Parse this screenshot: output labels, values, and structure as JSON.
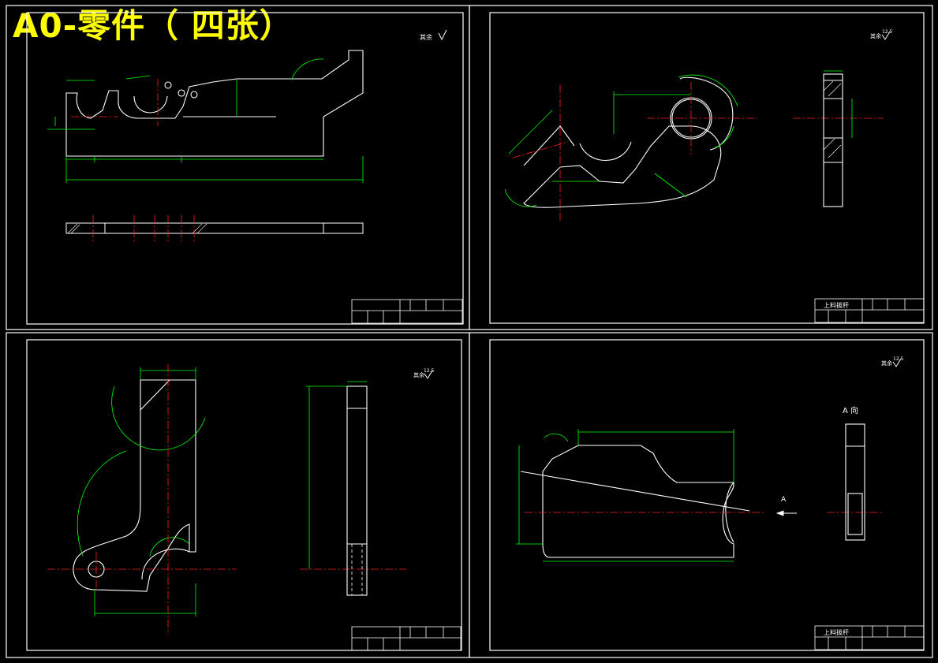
{
  "banner": {
    "title": "A0-零件（ 四张）"
  },
  "colors": {
    "background": "#000000",
    "frame": "#ffffff",
    "geometry": "#ffffff",
    "dimension": "#00ff00",
    "centerline": "#ff2020",
    "title_text": "#ffff00",
    "hatch": "#ffffff"
  },
  "sheets": [
    {
      "id": "top-left",
      "roughness_note": "其余",
      "roughness_value": "",
      "title_block": {
        "part_name": "",
        "cells": [
          "",
          "",
          "",
          "",
          "",
          ""
        ]
      }
    },
    {
      "id": "top-right",
      "roughness_note": "其余",
      "roughness_value": "12.5",
      "title_block": {
        "part_name": "上料拨杆",
        "cells": [
          "",
          "",
          "",
          "",
          "",
          ""
        ]
      }
    },
    {
      "id": "bottom-left",
      "roughness_note": "其余",
      "roughness_value": "12.5",
      "title_block": {
        "part_name": "",
        "cells": [
          "",
          "",
          "",
          "",
          "",
          ""
        ]
      }
    },
    {
      "id": "bottom-right",
      "roughness_note": "其余",
      "roughness_value": "12.5",
      "view_label": "A 向",
      "arrow_label": "A",
      "title_block": {
        "part_name": "上料拨杆",
        "cells": [
          "",
          "",
          "",
          "",
          "",
          ""
        ]
      }
    }
  ]
}
